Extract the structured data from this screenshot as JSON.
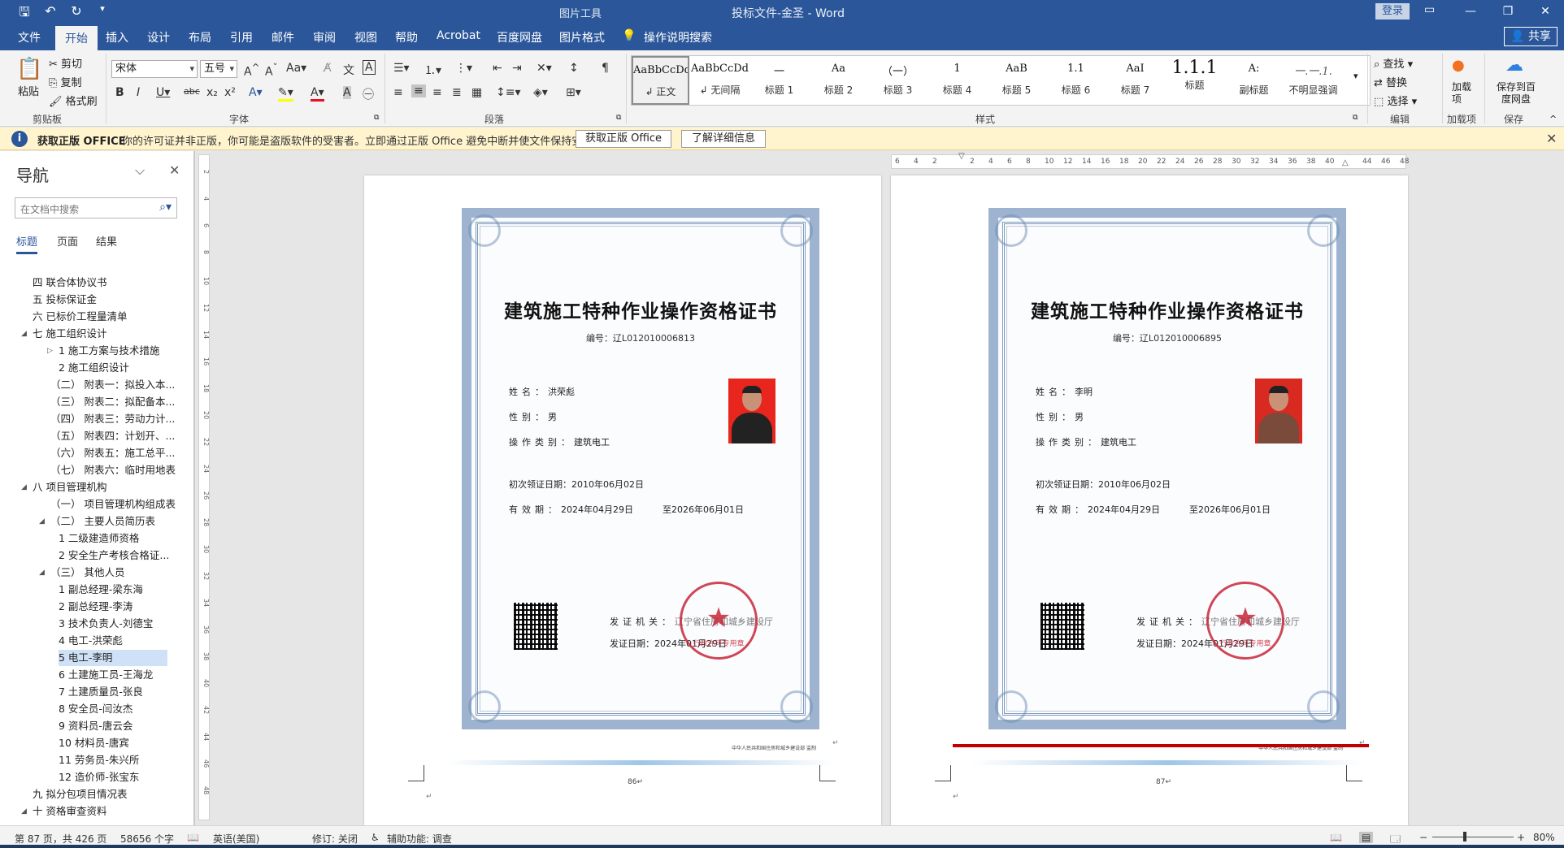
{
  "titlebar": {
    "qa_icons": [
      "save-icon",
      "undo-icon",
      "redo-icon",
      "customize-icon"
    ],
    "context_tab_group": "图片工具",
    "title": "投标文件-金圣  -  Word",
    "login": "登录"
  },
  "tabs": [
    {
      "label": "文件"
    },
    {
      "label": "开始"
    },
    {
      "label": "插入"
    },
    {
      "label": "设计"
    },
    {
      "label": "布局"
    },
    {
      "label": "引用"
    },
    {
      "label": "邮件"
    },
    {
      "label": "审阅"
    },
    {
      "label": "视图"
    },
    {
      "label": "帮助"
    },
    {
      "label": "Acrobat"
    },
    {
      "label": "百度网盘"
    },
    {
      "label": "图片格式"
    }
  ],
  "tell_me": "操作说明搜索",
  "share": "共享",
  "ribbon": {
    "clipboard": {
      "paste": "粘贴",
      "cut": "剪切",
      "copy": "复制",
      "format_painter": "格式刷",
      "label": "剪贴板"
    },
    "font": {
      "name": "宋体",
      "size": "五号",
      "label": "字体"
    },
    "paragraph": {
      "label": "段落"
    },
    "styles": {
      "label": "样式",
      "items": [
        {
          "sample": "AaBbCcDdI",
          "name": "↲ 正文"
        },
        {
          "sample": "AaBbCcDdI",
          "name": "↲ 无间隔"
        },
        {
          "sample": "一",
          "name": "标题 1"
        },
        {
          "sample": "Aa",
          "name": "标题 2"
        },
        {
          "sample": "（一）",
          "name": "标题 3"
        },
        {
          "sample": "1",
          "name": "标题 4"
        },
        {
          "sample": "AaB",
          "name": "标题 5"
        },
        {
          "sample": "1.1",
          "name": "标题 6"
        },
        {
          "sample": "AaI",
          "name": "标题 7"
        },
        {
          "sample": "1.1.1",
          "name": "标题"
        },
        {
          "sample": "A:",
          "name": "副标题"
        },
        {
          "sample": "一.一.1.",
          "name": "不明显强调"
        }
      ]
    },
    "editing": {
      "find": "查找",
      "replace": "替换",
      "select": "选择",
      "label": "编辑"
    },
    "addins": {
      "btn": "加载项",
      "label": "加载项"
    },
    "save": {
      "btn": "保存到百度网盘",
      "label": "保存"
    }
  },
  "warning": {
    "title": "获取正版 OFFICE",
    "message": "你的许可证并非正版，你可能是盗版软件的受害者。立即通过正版 Office 避免中断并使文件保持安全。",
    "btn_get": "获取正版 Office",
    "btn_more": "了解详细信息"
  },
  "nav": {
    "title": "导航",
    "search_placeholder": "在文档中搜索",
    "tabs": [
      "标题",
      "页面",
      "结果"
    ],
    "items": [
      {
        "label": "四 联合体协议书",
        "indent": 0,
        "arrow": ""
      },
      {
        "label": "五 投标保证金",
        "indent": 0,
        "arrow": ""
      },
      {
        "label": "六 已标价工程量清单",
        "indent": 0,
        "arrow": ""
      },
      {
        "label": "七 施工组织设计",
        "indent": 0,
        "arrow": "expanded"
      },
      {
        "label": "1 施工方案与技术措施",
        "indent": 2,
        "arrow": "collapsed"
      },
      {
        "label": "2 施工组织设计",
        "indent": 2,
        "arrow": ""
      },
      {
        "label": "（二） 附表一：拟投入本...",
        "indent": 1,
        "arrow": ""
      },
      {
        "label": "（三） 附表二：拟配备本...",
        "indent": 1,
        "arrow": ""
      },
      {
        "label": "（四） 附表三：劳动力计...",
        "indent": 1,
        "arrow": ""
      },
      {
        "label": "（五） 附表四：计划开、...",
        "indent": 1,
        "arrow": ""
      },
      {
        "label": "（六） 附表五：施工总平...",
        "indent": 1,
        "arrow": ""
      },
      {
        "label": "（七） 附表六：临时用地表",
        "indent": 1,
        "arrow": ""
      },
      {
        "label": "八 项目管理机构",
        "indent": 0,
        "arrow": "expanded"
      },
      {
        "label": "（一） 项目管理机构组成表",
        "indent": 1,
        "arrow": ""
      },
      {
        "label": "（二） 主要人员简历表",
        "indent": 1,
        "arrow": "expanded"
      },
      {
        "label": "1 二级建造师资格",
        "indent": 2,
        "arrow": ""
      },
      {
        "label": "2 安全生产考核合格证...",
        "indent": 2,
        "arrow": ""
      },
      {
        "label": "（三） 其他人员",
        "indent": 1,
        "arrow": "expanded"
      },
      {
        "label": "1 副总经理-梁东海",
        "indent": 2,
        "arrow": ""
      },
      {
        "label": "2 副总经理-李涛",
        "indent": 2,
        "arrow": ""
      },
      {
        "label": "3 技术负责人-刘德宝",
        "indent": 2,
        "arrow": ""
      },
      {
        "label": "4 电工-洪荣彪",
        "indent": 2,
        "arrow": ""
      },
      {
        "label": "5 电工-李明",
        "indent": 2,
        "arrow": "",
        "selected": true
      },
      {
        "label": "6 土建施工员-王海龙",
        "indent": 2,
        "arrow": ""
      },
      {
        "label": "7 土建质量员-张良",
        "indent": 2,
        "arrow": ""
      },
      {
        "label": "8 安全员-闫汝杰",
        "indent": 2,
        "arrow": ""
      },
      {
        "label": "9 资料员-唐云会",
        "indent": 2,
        "arrow": ""
      },
      {
        "label": "10 材料员-唐宾",
        "indent": 2,
        "arrow": ""
      },
      {
        "label": "11 劳务员-朱兴所",
        "indent": 2,
        "arrow": ""
      },
      {
        "label": "12 造价师-张宝东",
        "indent": 2,
        "arrow": ""
      },
      {
        "label": "九 拟分包项目情况表",
        "indent": 0,
        "arrow": ""
      },
      {
        "label": "十 资格审查资料",
        "indent": 0,
        "arrow": "expanded"
      }
    ]
  },
  "vruler_ticks": [
    "2",
    "4",
    "6",
    "8",
    "10",
    "12",
    "14",
    "16",
    "18",
    "20",
    "22",
    "24",
    "26",
    "28",
    "30",
    "32",
    "34",
    "36",
    "38",
    "40",
    "42",
    "44",
    "46",
    "48"
  ],
  "hruler_ticks": [
    "6",
    "4",
    "2",
    "",
    "2",
    "4",
    "6",
    "8",
    "10",
    "12",
    "14",
    "16",
    "18",
    "20",
    "22",
    "24",
    "26",
    "28",
    "30",
    "32",
    "34",
    "36",
    "38",
    "40",
    "",
    "44",
    "46",
    "48"
  ],
  "pages": [
    {
      "cert_title": "建筑施工特种作业操作资格证书",
      "cert_no": "编号：辽L012010006813",
      "name_label": "姓名：",
      "name": "洪荣彪",
      "gender_label": "性别：",
      "gender": "男",
      "category_label": "操作类别：",
      "category": "建筑电工",
      "first_date": "初次领证日期：2010年06月02日",
      "valid_label": "有效期：",
      "valid_from": "2024年04月29日",
      "valid_to": "至2026年06月01日",
      "issuer_label": "发证机关：",
      "issuer": "辽宁省住房和城乡建设厅",
      "issue_date": "发证日期：2024年01月29日",
      "seal_text": "行政许可专用章",
      "footer_text": "中华人民共和国住房和城乡建设部 监制",
      "page_num": "86↵"
    },
    {
      "cert_title": "建筑施工特种作业操作资格证书",
      "cert_no": "编号：辽L012010006895",
      "name_label": "姓名：",
      "name": "李明",
      "gender_label": "性别：",
      "gender": "男",
      "category_label": "操作类别：",
      "category": "建筑电工",
      "first_date": "初次领证日期：2010年06月02日",
      "valid_label": "有效期：",
      "valid_from": "2024年04月29日",
      "valid_to": "至2026年06月01日",
      "issuer_label": "发证机关：",
      "issuer": "辽宁省住房和城乡建设厅",
      "issue_date": "发证日期：2024年01月29日",
      "seal_text": "行政许可专用章",
      "footer_text": "中华人民共和国住房和城乡建设部 监制",
      "page_num": "87↵"
    }
  ],
  "status": {
    "page": "第 87 页，共 426 页",
    "words": "58656 个字",
    "language": "英语(美国)",
    "track_changes": "修订: 关闭",
    "accessibility": "辅助功能: 调查",
    "zoom": "80%"
  },
  "colors": {
    "accent": "#2b579a",
    "warning_bg": "#fff4ce",
    "seal": "#c8283a",
    "photo_bg": "#e8261e",
    "redline": "#c00000"
  }
}
